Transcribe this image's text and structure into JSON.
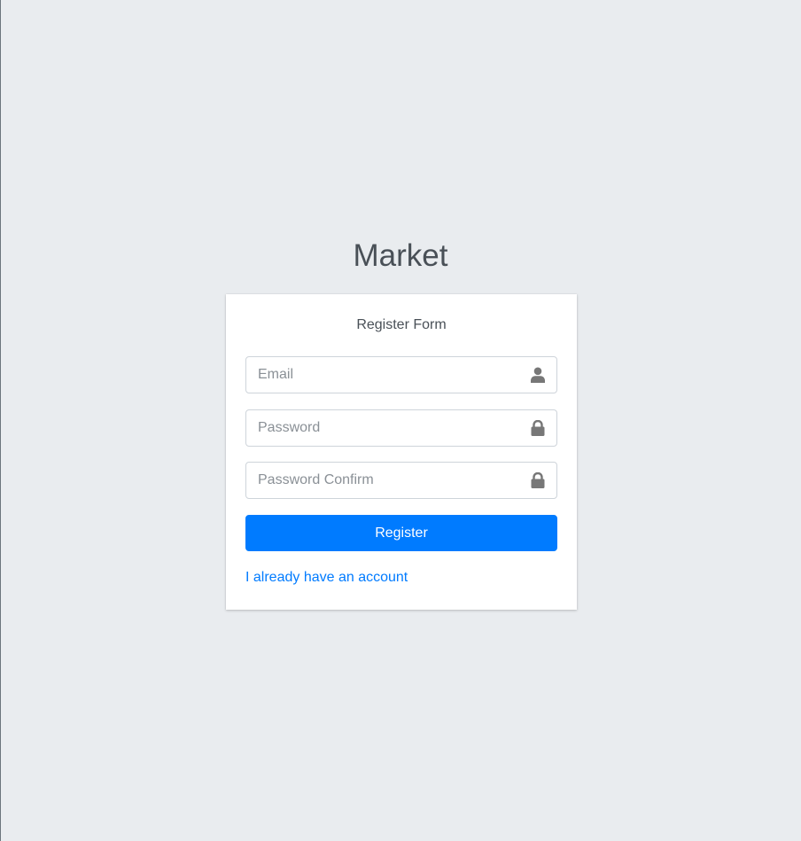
{
  "app": {
    "logo_text": "Market"
  },
  "register_form": {
    "message": "Register Form",
    "email": {
      "placeholder": "Email",
      "value": "",
      "icon": "user-icon"
    },
    "password": {
      "placeholder": "Password",
      "value": "",
      "icon": "lock-icon"
    },
    "password_confirm": {
      "placeholder": "Password Confirm",
      "value": "",
      "icon": "lock-icon"
    },
    "submit_label": "Register",
    "login_link_label": "I already have an account"
  },
  "colors": {
    "background": "#e9ecef",
    "card": "#ffffff",
    "primary": "#007bff",
    "icon": "#777777"
  }
}
